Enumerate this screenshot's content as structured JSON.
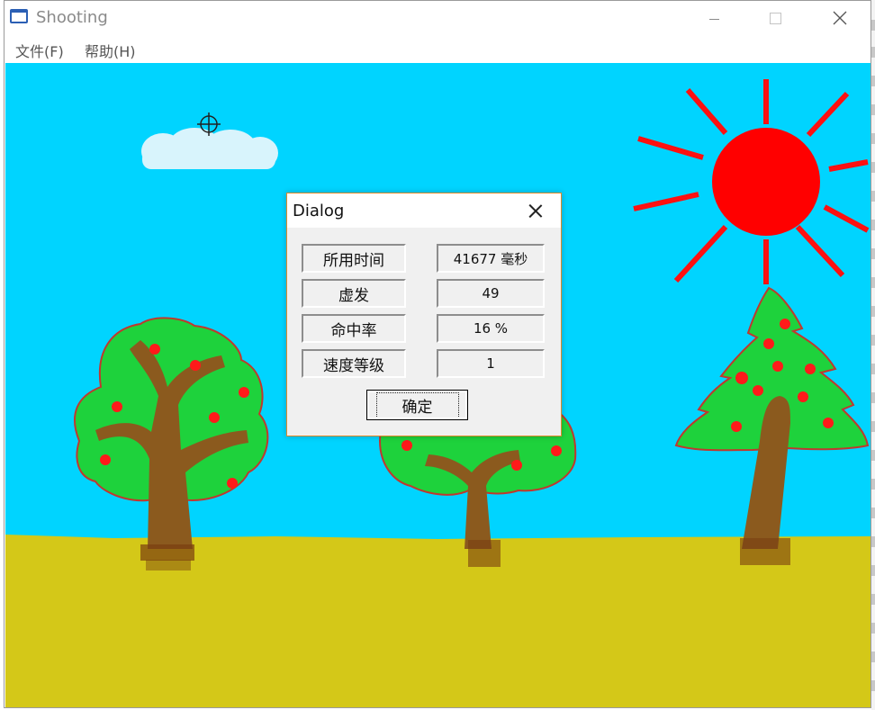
{
  "window": {
    "title": "Shooting",
    "icon": "app-window-icon",
    "controls": [
      "minimize-icon",
      "maximize-icon",
      "close-icon"
    ]
  },
  "menu": {
    "items": [
      {
        "label": "文件(F)"
      },
      {
        "label": "帮助(H)"
      }
    ]
  },
  "dialog": {
    "title": "Dialog",
    "rows": [
      {
        "label": "所用时间",
        "value": "41677 毫秒"
      },
      {
        "label": "虚发",
        "value": "49"
      },
      {
        "label": "命中率",
        "value": "16 %"
      },
      {
        "label": "速度等级",
        "value": "1"
      }
    ],
    "ok_label": "确定"
  },
  "scene": {
    "sky_color": "#00d4ff",
    "ground_color": "#d4c818",
    "sun_color": "#ff0000",
    "foliage_color": "#1ed23c",
    "trunk_color": "#8b5a1e",
    "cloud_color": "#d8f4fc",
    "crosshair": "crosshair-icon"
  }
}
